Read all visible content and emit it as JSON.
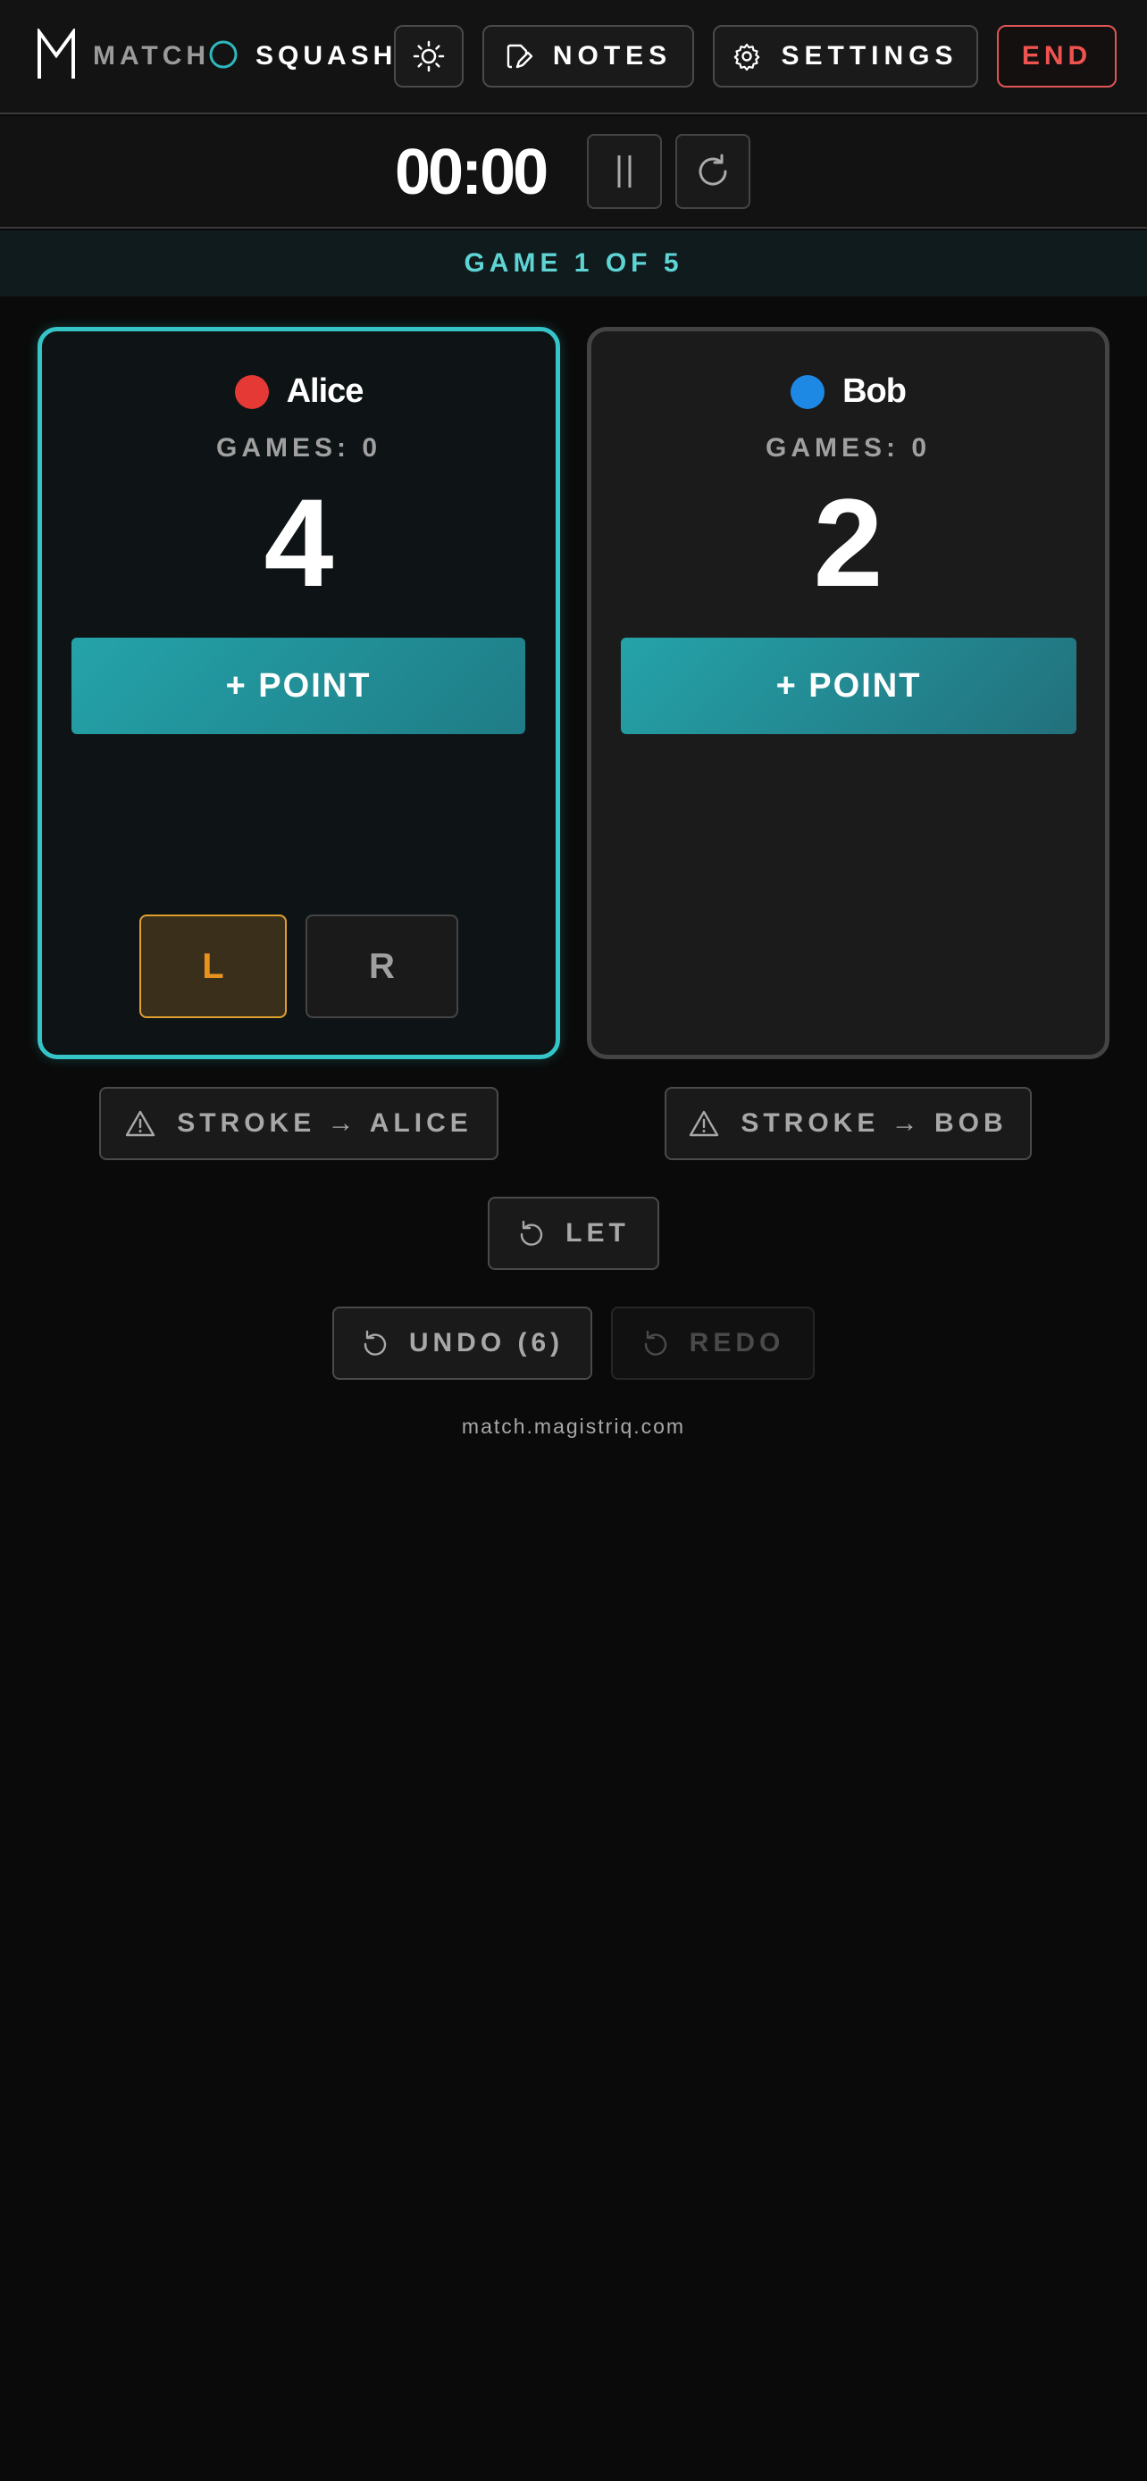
{
  "header": {
    "brand_match": "MATCH",
    "brand_squash": "SQUASH",
    "notes_label": "NOTES",
    "settings_label": "SETTINGS",
    "end_label": "END"
  },
  "timer": {
    "value": "00:00"
  },
  "game": {
    "banner": "GAME 1 OF 5"
  },
  "players": [
    {
      "name": "Alice",
      "games_label": "GAMES: 0",
      "score": "4",
      "point_label": "+ POINT",
      "dot_color": "#e53935",
      "selected": true
    },
    {
      "name": "Bob",
      "games_label": "GAMES: 0",
      "score": "2",
      "point_label": "+ POINT",
      "dot_color": "#1e88e5",
      "selected": false
    }
  ],
  "serve_side": {
    "left_label": "L",
    "right_label": "R",
    "selected": "L"
  },
  "actions": {
    "stroke_alice": "STROKE → ALICE",
    "stroke_bob": "STROKE → BOB",
    "let": "LET",
    "undo": "UNDO (6)",
    "redo": "REDO"
  },
  "footer": {
    "url": "match.magistriq.com"
  },
  "colors": {
    "accent": "#35c4c8",
    "point_button": "#24a3a9",
    "end": "#ef5350",
    "serve_selected": "#e89320"
  },
  "icons": {
    "theme": "sun-icon",
    "notes": "pencil-note-icon",
    "settings": "gear-icon",
    "pause": "pause-icon",
    "reset": "refresh-icon",
    "stroke": "warning-icon",
    "let": "rotate-ccw-icon",
    "undo": "undo-icon",
    "redo": "redo-icon"
  }
}
